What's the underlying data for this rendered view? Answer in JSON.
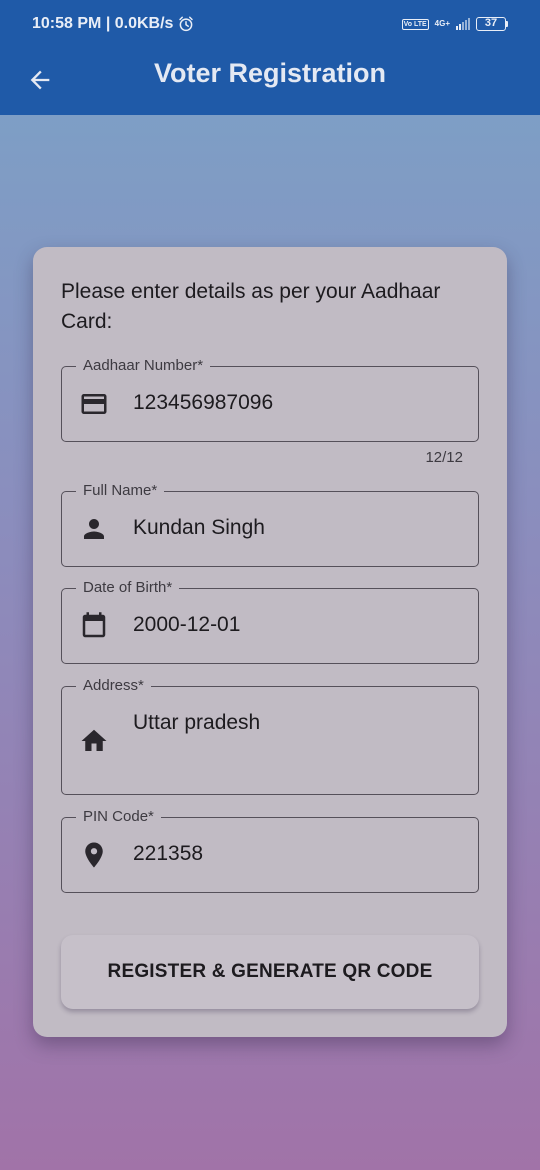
{
  "status_bar": {
    "time_info": "10:58 PM | 0.0KB/s",
    "alarm_icon": "alarm-icon",
    "volte": "Vo LTE",
    "network": "4G+",
    "battery": "37"
  },
  "app_bar": {
    "back_icon": "arrow-back-icon",
    "title": "Voter Registration"
  },
  "form": {
    "intro": "Please enter details as per your Aadhaar Card:",
    "fields": [
      {
        "label": "Aadhaar Number*",
        "value": "123456987096",
        "icon": "credit-card-icon",
        "counter": "12/12"
      },
      {
        "label": "Full Name*",
        "value": "Kundan Singh",
        "icon": "person-icon"
      },
      {
        "label": "Date of Birth*",
        "value": "2000-12-01",
        "icon": "calendar-icon"
      },
      {
        "label": "Address*",
        "value": "Uttar pradesh",
        "icon": "home-icon"
      },
      {
        "label": "PIN Code*",
        "value": "221358",
        "icon": "location-pin-icon"
      }
    ],
    "submit_label": "REGISTER & GENERATE QR CODE"
  },
  "colors": {
    "app_bar": "#1f5aa8",
    "card": "#c1bbc4",
    "background_top": "#7aa3c8",
    "background_bottom": "#a173a8"
  }
}
